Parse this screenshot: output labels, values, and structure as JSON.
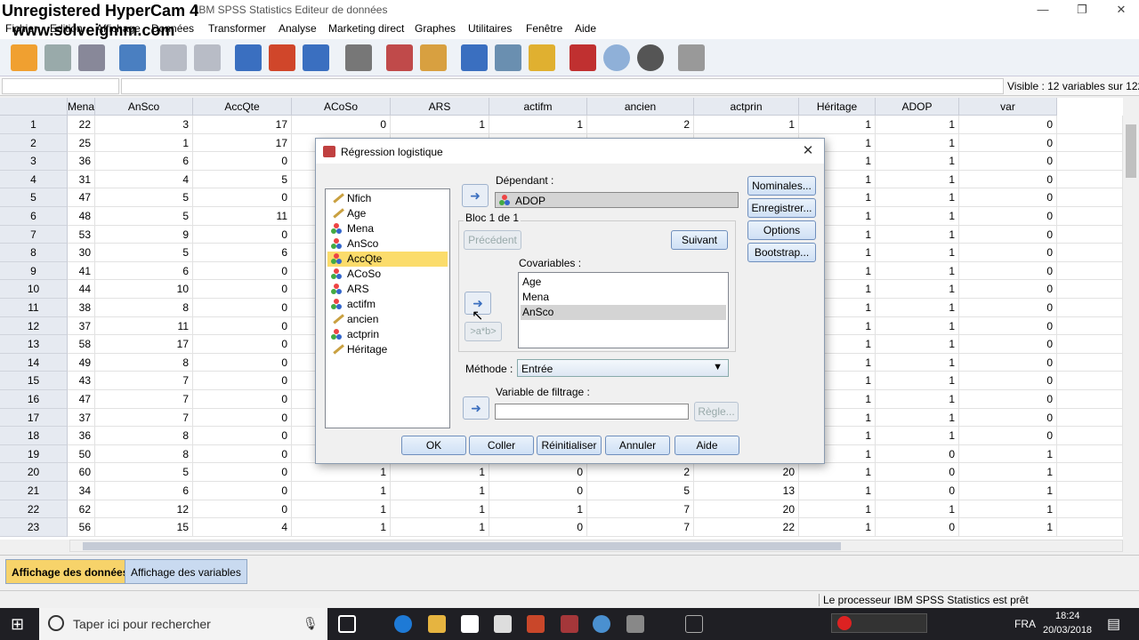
{
  "window": {
    "title": "IBM SPSS Statistics Editeur de données",
    "watermark1": "Unregistered HyperCam 4",
    "watermark2": "www.solveigmm.com"
  },
  "menu": [
    "Fichier",
    "Edition",
    "Affichage",
    "Données",
    "Transformer",
    "Analyse",
    "Marketing direct",
    "Graphes",
    "Utilitaires",
    "Fenêtre",
    "Aide"
  ],
  "visible_text": "Visible : 12 variables sur 122",
  "columns": [
    "",
    "Mena",
    "AnSco",
    "AccQte",
    "ACoSo",
    "ARS",
    "actifm",
    "ancien",
    "actprin",
    "Héritage",
    "ADOP",
    "var"
  ],
  "rows": [
    [
      "1",
      "22",
      "3",
      "17",
      "0",
      "1",
      "1",
      "2",
      "1",
      "1",
      "1",
      "0"
    ],
    [
      "2",
      "25",
      "1",
      "17",
      "",
      "",
      "",
      "",
      "",
      "1",
      "1",
      "0"
    ],
    [
      "3",
      "36",
      "6",
      "0",
      "",
      "",
      "",
      "",
      "",
      "1",
      "1",
      "0"
    ],
    [
      "4",
      "31",
      "4",
      "5",
      "",
      "",
      "",
      "",
      "",
      "1",
      "1",
      "0"
    ],
    [
      "5",
      "47",
      "5",
      "0",
      "",
      "",
      "",
      "",
      "",
      "1",
      "1",
      "0"
    ],
    [
      "6",
      "48",
      "5",
      "11",
      "",
      "",
      "",
      "",
      "",
      "1",
      "1",
      "0"
    ],
    [
      "7",
      "53",
      "9",
      "0",
      "",
      "",
      "",
      "",
      "",
      "1",
      "1",
      "0"
    ],
    [
      "8",
      "30",
      "5",
      "6",
      "",
      "",
      "",
      "",
      "",
      "1",
      "1",
      "0"
    ],
    [
      "9",
      "41",
      "6",
      "0",
      "",
      "",
      "",
      "",
      "",
      "1",
      "1",
      "0"
    ],
    [
      "10",
      "44",
      "10",
      "0",
      "",
      "",
      "",
      "",
      "",
      "1",
      "1",
      "0"
    ],
    [
      "11",
      "38",
      "8",
      "0",
      "",
      "",
      "",
      "",
      "",
      "1",
      "1",
      "0"
    ],
    [
      "12",
      "37",
      "11",
      "0",
      "",
      "",
      "",
      "",
      "",
      "1",
      "1",
      "0"
    ],
    [
      "13",
      "58",
      "17",
      "0",
      "",
      "",
      "",
      "",
      "",
      "1",
      "1",
      "0"
    ],
    [
      "14",
      "49",
      "8",
      "0",
      "",
      "",
      "",
      "",
      "",
      "1",
      "1",
      "0"
    ],
    [
      "15",
      "43",
      "7",
      "0",
      "",
      "",
      "",
      "",
      "",
      "1",
      "1",
      "0"
    ],
    [
      "16",
      "47",
      "7",
      "0",
      "",
      "",
      "",
      "",
      "",
      "1",
      "1",
      "0"
    ],
    [
      "17",
      "37",
      "7",
      "0",
      "",
      "",
      "",
      "",
      "",
      "1",
      "1",
      "0"
    ],
    [
      "18",
      "36",
      "8",
      "0",
      "",
      "",
      "",
      "",
      "",
      "1",
      "1",
      "0"
    ],
    [
      "19",
      "50",
      "8",
      "0",
      "",
      "",
      "",
      "",
      "",
      "1",
      "0",
      "1"
    ],
    [
      "20",
      "60",
      "5",
      "0",
      "1",
      "1",
      "0",
      "2",
      "20",
      "1",
      "0",
      "1"
    ],
    [
      "21",
      "34",
      "6",
      "0",
      "1",
      "1",
      "0",
      "5",
      "13",
      "1",
      "0",
      "1"
    ],
    [
      "22",
      "62",
      "12",
      "0",
      "1",
      "1",
      "1",
      "7",
      "20",
      "1",
      "1",
      "1"
    ],
    [
      "23",
      "56",
      "15",
      "4",
      "1",
      "1",
      "0",
      "7",
      "22",
      "1",
      "0",
      "1"
    ]
  ],
  "tabs": {
    "data": "Affichage des données",
    "vars": "Affichage des variables"
  },
  "status": "Le processeur IBM SPSS Statistics  est prêt",
  "taskbar": {
    "search": "Taper ici pour rechercher",
    "lang": "FRA",
    "time": "18:24",
    "date": "20/03/2018"
  },
  "dialog": {
    "title": "Régression logistique",
    "variables": [
      {
        "n": "Nfich",
        "t": "scale"
      },
      {
        "n": "Age",
        "t": "scale"
      },
      {
        "n": "Mena",
        "t": "nominal"
      },
      {
        "n": "AnSco",
        "t": "nominal"
      },
      {
        "n": "AccQte",
        "t": "nominal",
        "sel": true
      },
      {
        "n": "ACoSo",
        "t": "nominal"
      },
      {
        "n": "ARS",
        "t": "nominal"
      },
      {
        "n": "actifm",
        "t": "nominal"
      },
      {
        "n": "ancien",
        "t": "scale"
      },
      {
        "n": "actprin",
        "t": "nominal"
      },
      {
        "n": "Héritage",
        "t": "scale"
      }
    ],
    "dependent_label": "Dépendant :",
    "dependent": "ADOP",
    "block": "Bloc 1 de 1",
    "prev": "Précédent",
    "next": "Suivant",
    "covariates_label": "Covariables :",
    "covariates": [
      "Age",
      "Mena",
      "AnSco"
    ],
    "interaction": ">a*b>",
    "method_label": "Méthode :",
    "method": "Entrée",
    "filter_label": "Variable de filtrage :",
    "rule": "Règle...",
    "right": [
      "Nominales...",
      "Enregistrer...",
      "Options",
      "Bootstrap..."
    ],
    "bottom": [
      "OK",
      "Coller",
      "Réinitialiser",
      "Annuler",
      "Aide"
    ]
  }
}
